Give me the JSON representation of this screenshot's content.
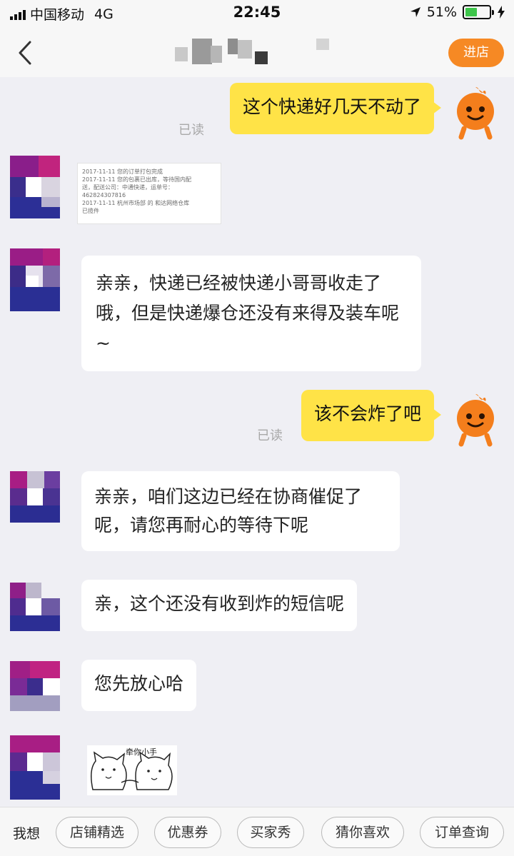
{
  "status_bar": {
    "carrier": "中国移动",
    "network": "4G",
    "time": "22:45",
    "battery_text": "51%",
    "battery_level": 0.51
  },
  "nav": {
    "enter_store": "进店",
    "accent": "#f68924"
  },
  "messages": [
    {
      "from": "me",
      "text": "这个快递好几天不动了",
      "read": "已读"
    },
    {
      "from": "them",
      "type": "image",
      "lines": [
        "2017-11-11  您的订单打包完成",
        "2017-11-11  您的包裹已出库，等待国内配",
        "送，配送公司：中通快递，运单号：",
        "462824307816",
        "2017-11-11  杭州市场部 的 和达网络仓库",
        "已揽件"
      ]
    },
    {
      "from": "them",
      "text": "亲亲，快递已经被快递小哥哥收走了哦，但是快递爆仓还没有来得及装车呢~"
    },
    {
      "from": "me",
      "text": "该不会炸了吧",
      "read": "已读"
    },
    {
      "from": "them",
      "text": "亲亲，咱们这边已经在协商催促了呢，请您再耐心的等待下呢"
    },
    {
      "from": "them",
      "text": "亲，这个还没有收到炸的短信呢"
    },
    {
      "from": "them",
      "text": "您先放心哈"
    },
    {
      "from": "them",
      "type": "sticker",
      "caption": "牵你小手"
    }
  ],
  "bottom": {
    "label": "我想",
    "chips": [
      "店铺精选",
      "优惠券",
      "买家秀",
      "猜你喜欢",
      "订单查询"
    ]
  },
  "colors": {
    "my_bubble": "#ffe347",
    "their_bubble": "#ffffff",
    "background": "#efeff4"
  },
  "icons": [
    "back-arrow-icon",
    "location-arrow-icon",
    "battery-icon",
    "signal-icon",
    "charging-icon"
  ]
}
